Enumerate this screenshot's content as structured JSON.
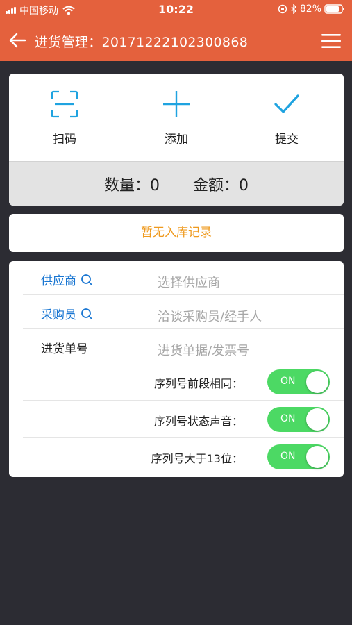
{
  "status_bar": {
    "carrier": "中国移动",
    "time": "10:22",
    "battery": "82%"
  },
  "nav": {
    "title": "进货管理：20171222102300868"
  },
  "actions": {
    "scan_label": "扫码",
    "add_label": "添加",
    "submit_label": "提交"
  },
  "summary": {
    "quantity_label": "数量：",
    "quantity_value": "0",
    "amount_label": "金额：",
    "amount_value": "0"
  },
  "empty_record": "暂无入库记录",
  "form": {
    "supplier_label": "供应商",
    "supplier_placeholder": "选择供应商",
    "buyer_label": "采购员",
    "buyer_placeholder": "洽谈采购员/经手人",
    "order_label": "进货单号",
    "order_placeholder": "进货单据/发票号"
  },
  "toggles": [
    {
      "label": "序列号前段相同：",
      "state": "ON",
      "on": true
    },
    {
      "label": "序列号状态声音：",
      "state": "ON",
      "on": true
    },
    {
      "label": "序列号大于13位：",
      "state": "ON",
      "on": true
    }
  ],
  "colors": {
    "header": "#e4613d",
    "background": "#2c2c33",
    "accent_blue": "#1fa3e0",
    "switch_on": "#4cd964",
    "empty_text": "#ef9a1e"
  }
}
